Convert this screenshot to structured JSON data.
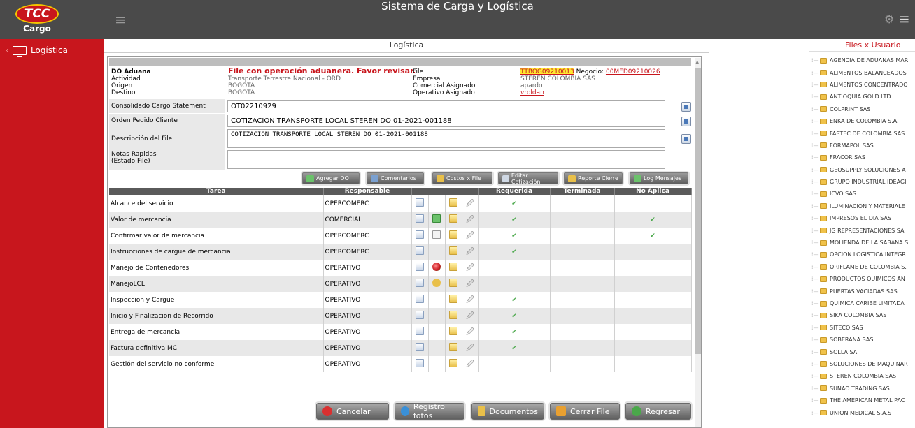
{
  "header": {
    "logo_text": "TCC",
    "logo_sub": "Cargo",
    "app_title": "Sistema de Carga y Logística"
  },
  "sidebar": {
    "items": [
      {
        "label": "Logística"
      }
    ]
  },
  "main": {
    "title": "Logística",
    "info": {
      "do_label": "DO Aduana",
      "warning": "File con operación aduanera. Favor revisar.",
      "actividad_label": "Actividad",
      "actividad": "Transporte Terrestre Nacional - ORD",
      "origen_label": "Origen",
      "origen": "BOGOTA",
      "destino_label": "Destino",
      "destino": "BOGOTA",
      "file_label": "File",
      "file": "TTBOG09210013",
      "negocio_label": "Negocio:",
      "negocio": "00MED09210026",
      "empresa_label": "Empresa",
      "empresa": "STEREN COLOMBIA SAS",
      "comercial_label": "Comercial Asignado",
      "comercial": "apardo",
      "operativo_label": "Operativo Asignado",
      "operativo": "vroldan"
    },
    "fields": [
      {
        "label": "Consolidado Cargo Statement",
        "value": "OT02210929"
      },
      {
        "label": "Orden Pedido Cliente",
        "value": "COTIZACION TRANSPORTE LOCAL STEREN DO 01-2021-001188"
      },
      {
        "label": "Descripción del File",
        "value": "COTIZACION TRANSPORTE LOCAL STEREN DO 01-2021-001188"
      },
      {
        "label": "Notas Rapidas\n(Estado File)",
        "value": ""
      }
    ],
    "toolbar": [
      "Agregar DO",
      "Comentarios",
      "Costos x File",
      "Editar Cotización",
      "Reporte Cierre",
      "Log Mensajes"
    ],
    "table": {
      "headers": [
        "Tarea",
        "Responsable",
        "Requerida",
        "Terminada",
        "No Aplica"
      ],
      "rows": [
        {
          "tarea": "Alcance del servicio",
          "resp": "OPERCOMERC",
          "req": "✔",
          "no": ""
        },
        {
          "tarea": "Valor de mercancia",
          "resp": "COMERCIAL",
          "req": "✔",
          "no": "✔"
        },
        {
          "tarea": "Confirmar valor de mercancia",
          "resp": "OPERCOMERC",
          "req": "✔",
          "no": "✔"
        },
        {
          "tarea": "Instrucciones de cargue de mercancia",
          "resp": "OPERCOMERC",
          "req": "✔",
          "no": ""
        },
        {
          "tarea": "Manejo de Contenedores",
          "resp": "OPERATIVO",
          "req": "",
          "no": ""
        },
        {
          "tarea": "ManejoLCL",
          "resp": "OPERATIVO",
          "req": "",
          "no": ""
        },
        {
          "tarea": "Inspeccion y Cargue",
          "resp": "OPERATIVO",
          "req": "✔",
          "no": ""
        },
        {
          "tarea": "Inicio y Finalizacion de Recorrido",
          "resp": "OPERATIVO",
          "req": "✔",
          "no": ""
        },
        {
          "tarea": "Entrega de mercancia",
          "resp": "OPERATIVO",
          "req": "✔",
          "no": ""
        },
        {
          "tarea": "Factura definitiva MC",
          "resp": "OPERATIVO",
          "req": "✔",
          "no": ""
        },
        {
          "tarea": "Gestión del servicio no conforme",
          "resp": "OPERATIVO",
          "req": "",
          "no": ""
        }
      ]
    },
    "buttons": {
      "cancelar": "Cancelar",
      "fotos": "Registro fotos",
      "documentos": "Documentos",
      "cerrar": "Cerrar File",
      "regresar": "Regresar"
    }
  },
  "right": {
    "title": "Files x Usuario",
    "items": [
      "AGENCIA DE ADUANAS MAR",
      "ALIMENTOS BALANCEADOS",
      "ALIMENTOS CONCENTRADO",
      "ANTIOQUIA GOLD LTD",
      "COLPRINT SAS",
      "ENKA DE COLOMBIA S.A.",
      "FASTEC DE COLOMBIA SAS",
      "FORMAPOL SAS",
      "FRACOR SAS",
      "GEOSUPPLY SOLUCIONES A",
      "GRUPO INDUSTRIAL IDEAGI",
      "ICVO SAS",
      "ILUMINACION Y MATERIALE",
      "IMPRESOS EL DIA SAS",
      "JG REPRESENTACIONES SA",
      "MOLIENDA DE LA SABANA S",
      "OPCION LOGISTICA INTEGR",
      "ORIFLAME DE COLOMBIA S.",
      "PRODUCTOS QUIMICOS AN",
      "PUERTAS VACIADAS SAS",
      "QUIMICA CARIBE LIMITADA",
      "SIKA COLOMBIA SAS",
      "SITECO SAS",
      "SOBERANA SAS",
      "SOLLA SA",
      "SOLUCIONES DE MAQUINAR",
      "STEREN COLOMBIA SAS",
      "SUNAO TRADING SAS",
      "THE AMERICAN METAL PAC",
      "UNION MEDICAL S.A.S"
    ]
  }
}
